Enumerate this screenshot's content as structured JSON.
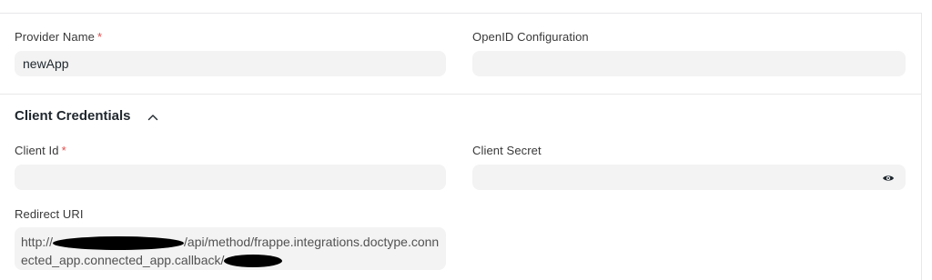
{
  "form": {
    "provider_name": {
      "label": "Provider Name",
      "required_mark": "*",
      "value": "newApp"
    },
    "openid_configuration": {
      "label": "OpenID Configuration",
      "value": ""
    },
    "client_credentials": {
      "title": "Client Credentials",
      "collapse_icon": "chevron-up-icon",
      "client_id": {
        "label": "Client Id",
        "required_mark": "*",
        "value": ""
      },
      "client_secret": {
        "label": "Client Secret",
        "value": "",
        "toggle_icon": "eye-icon"
      },
      "redirect_uri": {
        "label": "Redirect URI",
        "value_prefix": "http://",
        "value_middle": "/api/method/frappe.integrations.doctype.connected_app.connected_app.callback/"
      }
    }
  },
  "colors": {
    "required": "#e24c4c",
    "field_bg": "#f3f3f3",
    "divider": "#e8e8ea"
  }
}
